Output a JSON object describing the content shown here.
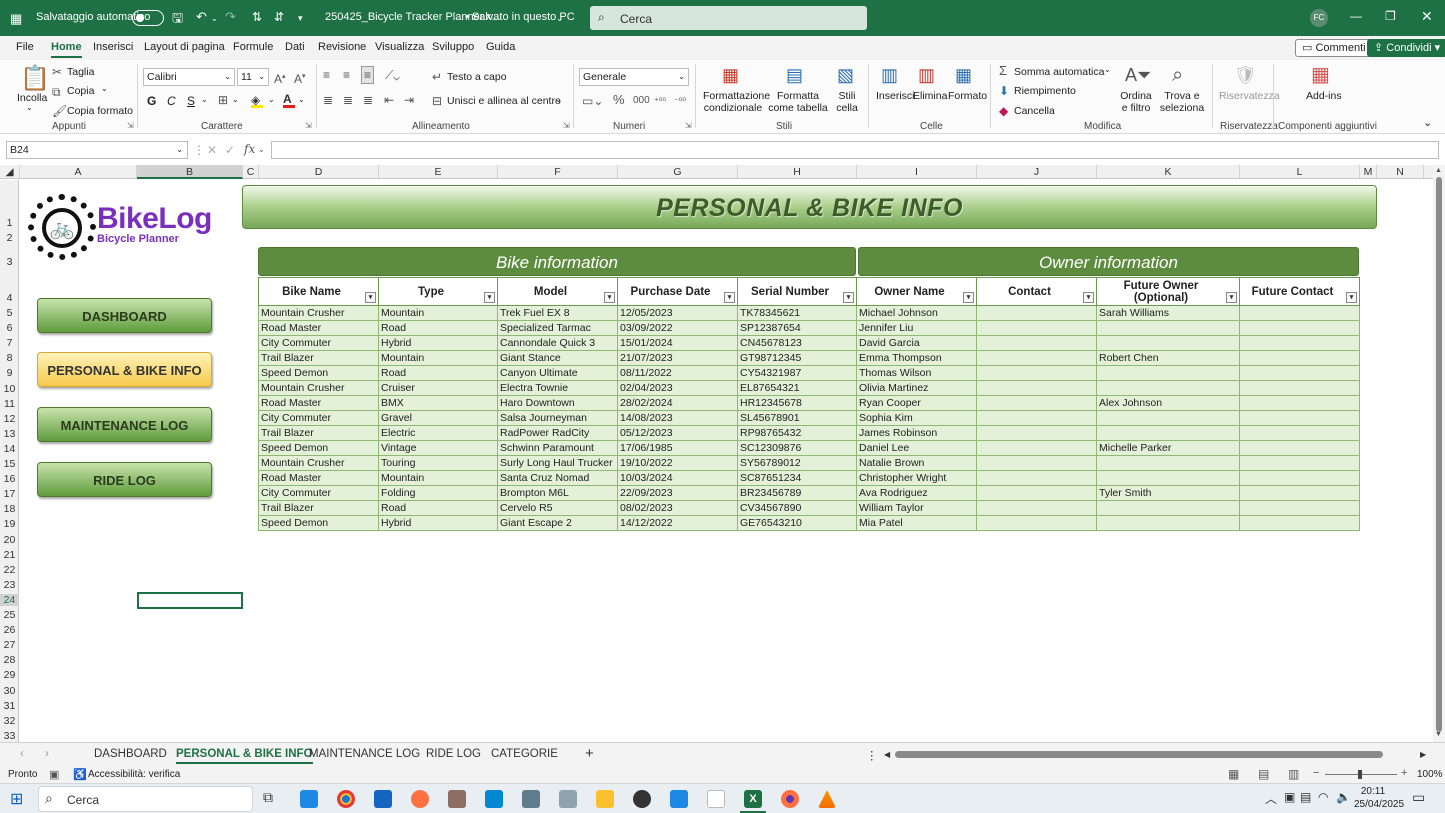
{
  "titlebar": {
    "autosave_label": "Salvataggio automatico",
    "filename": "250425_Bicycle Tracker Planner.x...",
    "saved_status": "• Salvato in questo PC",
    "search_placeholder": "Cerca",
    "user_initials": "FC"
  },
  "menu": {
    "tabs": [
      "File",
      "Home",
      "Inserisci",
      "Layout di pagina",
      "Formule",
      "Dati",
      "Revisione",
      "Visualizza",
      "Sviluppo",
      "Guida"
    ],
    "active": "Home",
    "comments_label": "Commenti",
    "share_label": "Condividi"
  },
  "ribbon": {
    "paste": "Incolla",
    "cut": "Taglia",
    "copy": "Copia",
    "format_painter": "Copia formato",
    "font_name": "Calibri",
    "font_size": "11",
    "bold": "G",
    "italic": "C",
    "underline": "S",
    "wrap_text": "Testo a capo",
    "merge_center": "Unisci e allinea al centro",
    "number_format": "Generale",
    "conditional_formatting": "Formattazione condizionale",
    "format_as_table": "Formatta come tabella",
    "cell_styles": "Stili cella",
    "insert": "Inserisci",
    "delete": "Elimina",
    "format": "Formato",
    "autosum": "Somma automatica",
    "fill": "Riempimento",
    "clear": "Cancella",
    "sort_filter": "Ordina e filtro",
    "find_select": "Trova e seleziona",
    "sensitivity": "Riservatezza",
    "addins": "Add-ins",
    "groups": {
      "clipboard": "Appunti",
      "font": "Carattere",
      "alignment": "Allineamento",
      "number": "Numeri",
      "styles": "Stili",
      "cells": "Celle",
      "editing": "Modifica",
      "sensitivity": "Riservatezza",
      "addins": "Componenti aggiuntivi"
    }
  },
  "formula_bar": {
    "name_box": "B24",
    "fx": "fx",
    "value": ""
  },
  "columns": [
    "A",
    "B",
    "C",
    "D",
    "E",
    "F",
    "G",
    "H",
    "I",
    "J",
    "K",
    "L",
    "M",
    "N"
  ],
  "rows": [
    "1",
    "2",
    "3",
    "4",
    "5",
    "6",
    "7",
    "8",
    "9",
    "10",
    "11",
    "12",
    "13",
    "14",
    "15",
    "16",
    "17",
    "18",
    "19",
    "20",
    "21",
    "22",
    "23",
    "24",
    "25",
    "26",
    "27",
    "28",
    "29",
    "30",
    "31",
    "32",
    "33"
  ],
  "selected_cell": {
    "column": "B",
    "row": "24"
  },
  "logo": {
    "name": "BikeLog",
    "tagline": "Bicycle Planner"
  },
  "nav_buttons": {
    "dashboard": "DASHBOARD",
    "personal": "PERSONAL & BIKE INFO",
    "maintenance": "MAINTENANCE LOG",
    "ride": "RIDE LOG"
  },
  "banner_title": "PERSONAL & BIKE INFO",
  "sections": {
    "bike": "Bike information",
    "owner": "Owner information"
  },
  "table": {
    "headers": [
      "Bike Name",
      "Type",
      "Model",
      "Purchase Date",
      "Serial Number",
      "Owner Name",
      "Contact",
      "Future Owner (Optional)",
      "Future Contact"
    ],
    "rows": [
      [
        "Mountain Crusher",
        "Mountain",
        "Trek Fuel EX 8",
        "12/05/2023",
        "TK78345621",
        "Michael Johnson",
        "",
        "Sarah Williams",
        ""
      ],
      [
        "Road Master",
        "Road",
        "Specialized Tarmac",
        "03/09/2022",
        "SP12387654",
        "Jennifer Liu",
        "",
        "",
        ""
      ],
      [
        "City Commuter",
        "Hybrid",
        "Cannondale Quick 3",
        "15/01/2024",
        "CN45678123",
        "David Garcia",
        "",
        "",
        ""
      ],
      [
        "Trail Blazer",
        "Mountain",
        "Giant Stance",
        "21/07/2023",
        "GT98712345",
        "Emma Thompson",
        "",
        "Robert Chen",
        ""
      ],
      [
        "Speed Demon",
        "Road",
        "Canyon Ultimate",
        "08/11/2022",
        "CY54321987",
        "Thomas Wilson",
        "",
        "",
        ""
      ],
      [
        "Mountain Crusher",
        "Cruiser",
        "Electra Townie",
        "02/04/2023",
        "EL87654321",
        "Olivia Martinez",
        "",
        "",
        ""
      ],
      [
        "Road Master",
        "BMX",
        "Haro Downtown",
        "28/02/2024",
        "HR12345678",
        "Ryan Cooper",
        "",
        "Alex Johnson",
        ""
      ],
      [
        "City Commuter",
        "Gravel",
        "Salsa Journeyman",
        "14/08/2023",
        "SL45678901",
        "Sophia Kim",
        "",
        "",
        ""
      ],
      [
        "Trail Blazer",
        "Electric",
        "RadPower RadCity",
        "05/12/2023",
        "RP98765432",
        "James Robinson",
        "",
        "",
        ""
      ],
      [
        "Speed Demon",
        "Vintage",
        "Schwinn Paramount",
        "17/06/1985",
        "SC12309876",
        "Daniel Lee",
        "",
        "Michelle Parker",
        ""
      ],
      [
        "Mountain Crusher",
        "Touring",
        "Surly Long Haul Trucker",
        "19/10/2022",
        "SY56789012",
        "Natalie Brown",
        "",
        "",
        ""
      ],
      [
        "Road Master",
        "Mountain",
        "Santa Cruz Nomad",
        "10/03/2024",
        "SC87651234",
        "Christopher Wright",
        "",
        "",
        ""
      ],
      [
        "City Commuter",
        "Folding",
        "Brompton M6L",
        "22/09/2023",
        "BR23456789",
        "Ava Rodriguez",
        "",
        "Tyler Smith",
        ""
      ],
      [
        "Trail Blazer",
        "Road",
        "Cervelo R5",
        "08/02/2023",
        "CV34567890",
        "William Taylor",
        "",
        "",
        ""
      ],
      [
        "Speed Demon",
        "Hybrid",
        "Giant Escape 2",
        "14/12/2022",
        "GE76543210",
        "Mia Patel",
        "",
        "",
        ""
      ]
    ]
  },
  "sheet_tabs": [
    "DASHBOARD",
    "PERSONAL & BIKE INFO",
    "MAINTENANCE LOG",
    "RIDE LOG",
    "CATEGORIE"
  ],
  "active_sheet": "PERSONAL & BIKE INFO",
  "status": {
    "ready": "Pronto",
    "accessibility": "Accessibilità: verifica",
    "zoom": "100%"
  },
  "taskbar": {
    "search": "Cerca",
    "time": "20:11",
    "date": "25/04/2025"
  },
  "colors": {
    "excel_green": "#1e7145",
    "section_green": "#5e8c3e",
    "row_fill": "#e3f1d8",
    "active_nav": "#f6c94c"
  }
}
